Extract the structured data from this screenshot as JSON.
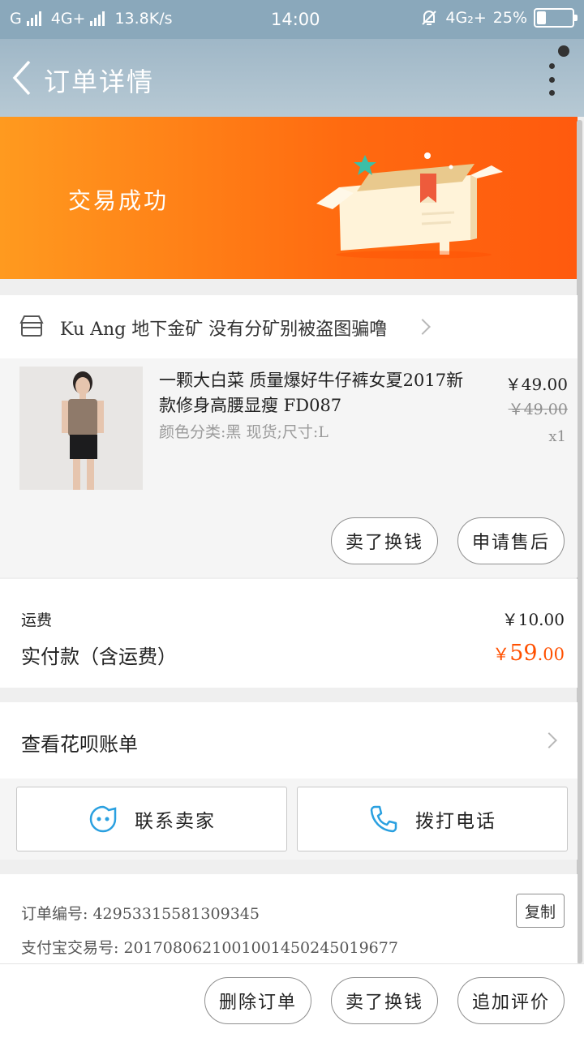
{
  "status_bar": {
    "carrier1": "G",
    "carrier2": "4G+",
    "speed": "13.8K/s",
    "time": "14:00",
    "network": "4G₂+",
    "battery_text": "25%",
    "battery_level": 0.25
  },
  "header": {
    "title": "订单详情"
  },
  "banner": {
    "status": "交易成功"
  },
  "shop": {
    "name": "Ku Ang 地下金矿 没有分矿别被盗图骗噜"
  },
  "product": {
    "title": "一颗大白菜 质量爆好牛仔裤女夏2017新款修身高腰显瘦 FD087",
    "sku": "颜色分类:黑 现货;尺寸:L",
    "price": "￥49.00",
    "original_price": "￥49.00",
    "quantity": "x1",
    "actions": [
      "卖了换钱",
      "申请售后"
    ]
  },
  "fees": {
    "shipping_label": "运费",
    "shipping_value": "￥10.00",
    "total_label": "实付款（含运费）",
    "total_currency": "￥",
    "total_int": "59",
    "total_dec": ".00"
  },
  "bill": {
    "label": "查看花呗账单"
  },
  "contact": {
    "seller_label": "联系卖家",
    "call_label": "拨打电话"
  },
  "order_info": {
    "order_no_label": "订单编号:",
    "order_no": "42953315581309345",
    "alipay_label": "支付宝交易号:",
    "alipay_no": "2017080621001001450245019677",
    "copy_label": "复制"
  },
  "bottom_actions": [
    "删除订单",
    "卖了换钱",
    "追加评价"
  ],
  "colors": {
    "accent": "#ff5000",
    "banner_start": "#ff9a1f",
    "banner_end": "#ff5a0e",
    "header": "#a9bfcc",
    "link_blue": "#2aa0e0"
  }
}
